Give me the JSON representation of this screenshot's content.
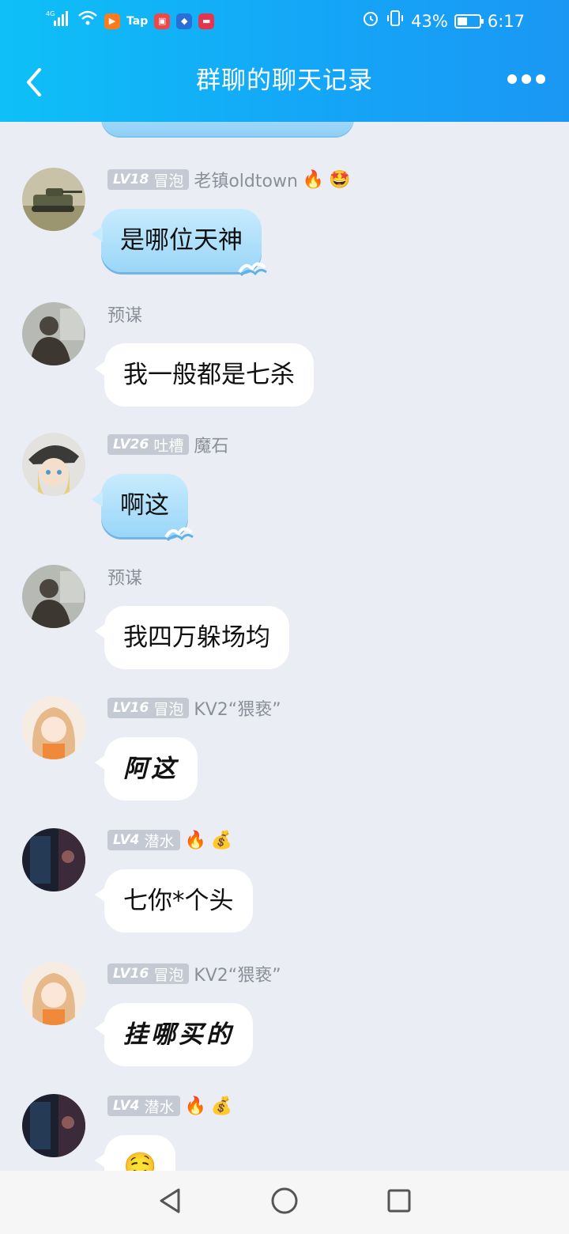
{
  "status_bar": {
    "network": "4G",
    "battery_percent": "43%",
    "time": "6:17",
    "tap_label": "Tap"
  },
  "header": {
    "title": "群聊的聊天记录"
  },
  "messages": [
    {
      "level": "LV18",
      "title": "冒泡",
      "name": "老镇oldtown",
      "text": "是哪位天神",
      "bubble": "wave"
    },
    {
      "level": "",
      "title": "",
      "name": "预谋",
      "text": "我一般都是七杀",
      "bubble": "plain"
    },
    {
      "level": "LV26",
      "title": "吐槽",
      "name": "魔石",
      "text": "啊这",
      "bubble": "wave"
    },
    {
      "level": "",
      "title": "",
      "name": "预谋",
      "text": "我四万躲场均",
      "bubble": "plain"
    },
    {
      "level": "LV16",
      "title": "冒泡",
      "name": "KV2“猥亵”",
      "text": "阿这",
      "bubble": "hand"
    },
    {
      "level": "LV4",
      "title": "潜水",
      "name": "",
      "text": "七你*个头",
      "bubble": "plain"
    },
    {
      "level": "LV16",
      "title": "冒泡",
      "name": "KV2“猥亵”",
      "text": "挂哪买的",
      "bubble": "hand"
    },
    {
      "level": "LV4",
      "title": "潜水",
      "name": "",
      "text": "🤤",
      "bubble": "plain"
    }
  ],
  "icons": {
    "fire": "🔥",
    "smiley_badge": "🤩",
    "green_badge": "💰"
  }
}
